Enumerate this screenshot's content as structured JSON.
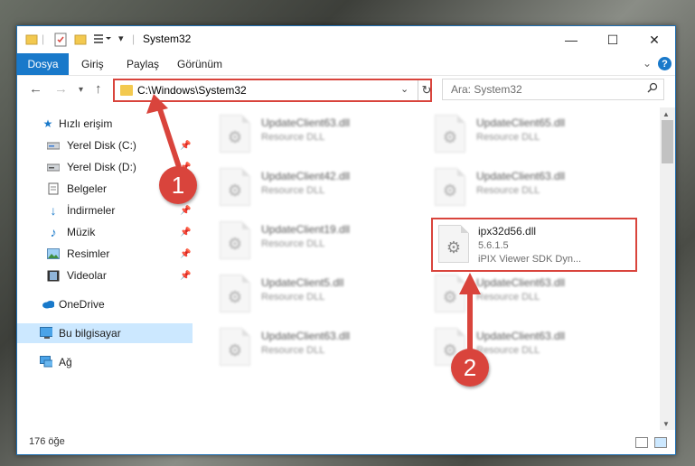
{
  "window": {
    "title": "System32",
    "buttons": {
      "minimize": "—",
      "maximize": "☐",
      "close": "✕"
    }
  },
  "ribbon": {
    "tabs": [
      "Dosya",
      "Giriş",
      "Paylaş",
      "Görünüm"
    ],
    "help": "?"
  },
  "nav": {
    "address_path": "C:\\Windows\\System32",
    "search_placeholder": "Ara: System32"
  },
  "sidebar": {
    "items": [
      {
        "label": "Hızlı erişim",
        "icon": "star-icon",
        "pinned": false
      },
      {
        "label": "Yerel Disk (C:)",
        "icon": "drive-icon",
        "pinned": true
      },
      {
        "label": "Yerel Disk (D:)",
        "icon": "drive-icon",
        "pinned": true
      },
      {
        "label": "Belgeler",
        "icon": "documents-icon",
        "pinned": true
      },
      {
        "label": "İndirmeler",
        "icon": "download-icon",
        "pinned": true
      },
      {
        "label": "Müzik",
        "icon": "music-icon",
        "pinned": true
      },
      {
        "label": "Resimler",
        "icon": "pictures-icon",
        "pinned": true
      },
      {
        "label": "Videolar",
        "icon": "videos-icon",
        "pinned": true
      },
      {
        "label": "OneDrive",
        "icon": "cloud-icon",
        "pinned": false
      },
      {
        "label": "Bu bilgisayar",
        "icon": "computer-icon",
        "pinned": false,
        "selected": true
      },
      {
        "label": "Ağ",
        "icon": "network-icon",
        "pinned": false
      }
    ]
  },
  "files": [
    {
      "name": "UpdateClient63.dll",
      "lines": [
        "Resource DLL"
      ],
      "blurred": true
    },
    {
      "name": "UpdateClient65.dll",
      "lines": [
        "Resource DLL"
      ],
      "blurred": true
    },
    {
      "name": "UpdateClient42.dll",
      "lines": [
        "Resource DLL"
      ],
      "blurred": true
    },
    {
      "name": "UpdateClient63.dll",
      "lines": [
        "Resource DLL"
      ],
      "blurred": true
    },
    {
      "name": "UpdateClient19.dll",
      "lines": [
        "Resource DLL"
      ],
      "blurred": true
    },
    {
      "name": "ipx32d56.dll",
      "lines": [
        "5.6.1.5",
        "iPIX Viewer SDK Dyn..."
      ],
      "blurred": false,
      "highlighted": true
    },
    {
      "name": "UpdateClient5.dll",
      "lines": [
        "Resource DLL"
      ],
      "blurred": true
    },
    {
      "name": "UpdateClient63.dll",
      "lines": [
        "Resource DLL"
      ],
      "blurred": true
    },
    {
      "name": "UpdateClient63.dll",
      "lines": [
        "Resource DLL"
      ],
      "blurred": true
    },
    {
      "name": "UpdateClient63.dll",
      "lines": [
        "Resource DLL"
      ],
      "blurred": true
    }
  ],
  "status": {
    "item_count": "176 öğe"
  },
  "annotations": [
    {
      "label": "1",
      "color": "#d9443c"
    },
    {
      "label": "2",
      "color": "#d9443c"
    }
  ]
}
